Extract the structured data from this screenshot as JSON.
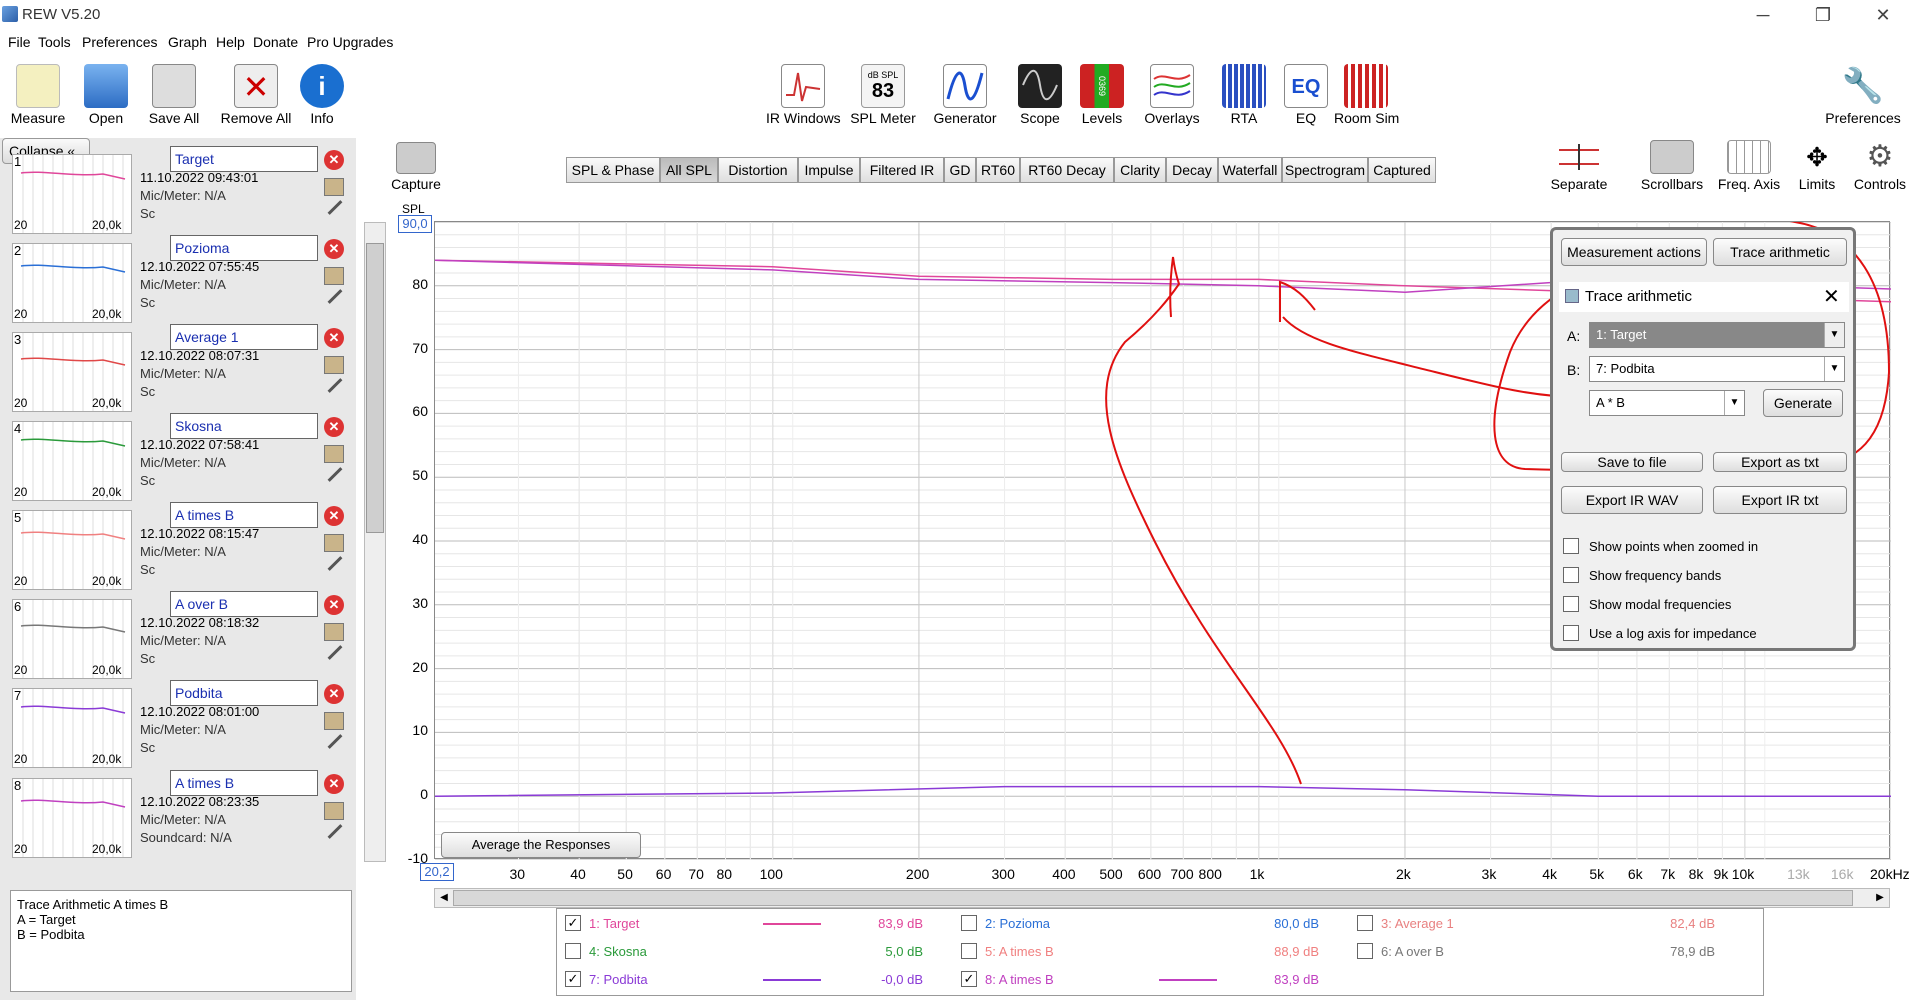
{
  "window": {
    "title": "REW V5.20"
  },
  "menu": [
    "File",
    "Tools",
    "Preferences",
    "Graph",
    "Help",
    "Donate",
    "Pro Upgrades"
  ],
  "toolbar": {
    "left": [
      "Measure",
      "Open",
      "Save All",
      "Remove All",
      "Info"
    ],
    "center": [
      "IR Windows",
      "SPL Meter",
      "Generator",
      "Scope",
      "Levels",
      "Overlays",
      "RTA",
      "EQ",
      "Room Sim"
    ],
    "spl_meter_badge": "dB SPL",
    "spl_meter_value": "83",
    "levels_digits": "0369",
    "eq_icon": "EQ",
    "right": "Preferences"
  },
  "leftpanel": {
    "collapse": "Collapse",
    "measurements": [
      {
        "num": "1",
        "name": "Target",
        "date": "11.10.2022 09:43:01",
        "mic": "Mic/Meter: N/A",
        "lo": "20",
        "hi": "20,0k",
        "color": "#e0469a"
      },
      {
        "num": "2",
        "name": "Pozioma",
        "date": "12.10.2022 07:55:45",
        "mic": "Mic/Meter: N/A",
        "lo": "20",
        "hi": "20,0k",
        "color": "#2a6fd6"
      },
      {
        "num": "3",
        "name": "Average 1",
        "date": "12.10.2022 08:07:31",
        "mic": "Mic/Meter: N/A",
        "lo": "20",
        "hi": "20,0k",
        "color": "#e04848"
      },
      {
        "num": "4",
        "name": "Skosna",
        "date": "12.10.2022 07:58:41",
        "mic": "Mic/Meter: N/A",
        "lo": "20",
        "hi": "20,0k",
        "color": "#2a9a3a"
      },
      {
        "num": "5",
        "name": "A times B",
        "date": "12.10.2022 08:15:47",
        "mic": "Mic/Meter: N/A",
        "lo": "20",
        "hi": "20,0k",
        "color": "#f08080"
      },
      {
        "num": "6",
        "name": "A over B",
        "date": "12.10.2022 08:18:32",
        "mic": "Mic/Meter: N/A",
        "lo": "20",
        "hi": "20,0k",
        "color": "#777777"
      },
      {
        "num": "7",
        "name": "Podbita",
        "date": "12.10.2022 08:01:00",
        "mic": "Mic/Meter: N/A",
        "lo": "20",
        "hi": "20,0k",
        "color": "#8a3ad6"
      },
      {
        "num": "8",
        "name": "A times B",
        "date": "12.10.2022 08:23:35",
        "mic": "Mic/Meter: N/A",
        "soundcard": "Soundcard: N/A",
        "lo": "20",
        "hi": "20,0k",
        "color": "#c040c0"
      }
    ],
    "sc_stub": "Sc",
    "note": [
      "Trace Arithmetic A times B",
      "A = Target",
      "B = Podbita"
    ]
  },
  "capture": "Capture",
  "tabs": [
    "SPL & Phase",
    "All SPL",
    "Distortion",
    "Impulse",
    "Filtered IR",
    "GD",
    "RT60",
    "RT60 Decay",
    "Clarity",
    "Decay",
    "Waterfall",
    "Spectrogram",
    "Captured"
  ],
  "right_tools": [
    "Separate",
    "Scrollbars",
    "Freq. Axis",
    "Limits",
    "Controls"
  ],
  "graph": {
    "ylabel": "SPL",
    "ymax_box": "90,0",
    "xmin_box": "20,2",
    "yticks": [
      "80",
      "70",
      "60",
      "50",
      "40",
      "30",
      "20",
      "10",
      "0",
      "-10"
    ],
    "xticks": [
      "30",
      "40",
      "50",
      "60",
      "70",
      "80",
      "100",
      "200",
      "300",
      "400",
      "500",
      "600",
      "700",
      "800",
      "1k",
      "2k",
      "3k",
      "4k",
      "5k",
      "6k",
      "7k",
      "8k",
      "9k",
      "10k",
      "13k",
      "16k",
      "20kHz"
    ],
    "avg_btn": "Average the Responses"
  },
  "chart_data": {
    "type": "line",
    "x_unit": "Hz",
    "y_unit": "dB",
    "xlim": [
      20.2,
      20000
    ],
    "ylim": [
      -10,
      90
    ],
    "log_x": true,
    "series": [
      {
        "name": "1: Target",
        "x": [
          20.2,
          100,
          200,
          500,
          1000,
          2000,
          5000
        ],
        "y": [
          84,
          83,
          81.5,
          81,
          81,
          80,
          79
        ]
      },
      {
        "name": "8: A times B",
        "x": [
          20.2,
          100,
          200,
          500,
          1000,
          2000,
          5000
        ],
        "y": [
          84,
          82.5,
          81,
          80.5,
          80,
          79,
          81
        ]
      },
      {
        "name": "7: Podbita",
        "x": [
          20.2,
          100,
          300,
          1000,
          2000,
          5000,
          20000
        ],
        "y": [
          0,
          0.5,
          1.5,
          1.5,
          1,
          0,
          0
        ]
      }
    ]
  },
  "legend": [
    {
      "label": "1: Target",
      "value": "83,9 dB",
      "checked": true,
      "color": "#e0469a",
      "line": true
    },
    {
      "label": "2: Pozioma",
      "value": "80,0 dB",
      "checked": false,
      "color": "#2a6fd6",
      "line": false
    },
    {
      "label": "3: Average 1",
      "value": "82,4 dB",
      "checked": false,
      "color": "#e88080",
      "line": false
    },
    {
      "label": "4: Skosna",
      "value": "5,0 dB",
      "checked": false,
      "color": "#2a9a3a",
      "line": false
    },
    {
      "label": "5: A times B",
      "value": "88,9 dB",
      "checked": false,
      "color": "#f08080",
      "line": false
    },
    {
      "label": "6: A over B",
      "value": "78,9 dB",
      "checked": false,
      "color": "#777777",
      "line": false
    },
    {
      "label": "7: Podbita",
      "value": "-0,0 dB",
      "checked": true,
      "color": "#8a3ad6",
      "line": true
    },
    {
      "label": "8: A times B",
      "value": "83,9 dB",
      "checked": true,
      "color": "#c040c0",
      "line": true
    }
  ],
  "dialog": {
    "measurement_actions": "Measurement actions",
    "trace_arithmetic": "Trace arithmetic",
    "title": "Trace arithmetic",
    "a_label": "A:",
    "a_value": "1: Target",
    "b_label": "B:",
    "b_value": "7: Podbita",
    "op_value": "A * B",
    "generate": "Generate",
    "save": "Save to file",
    "export_txt": "Export as txt",
    "export_wav": "Export IR WAV",
    "export_ir_txt": "Export IR txt",
    "options": [
      "Show points when zoomed in",
      "Show frequency bands",
      "Show modal frequencies",
      "Use a log axis for impedance"
    ]
  }
}
